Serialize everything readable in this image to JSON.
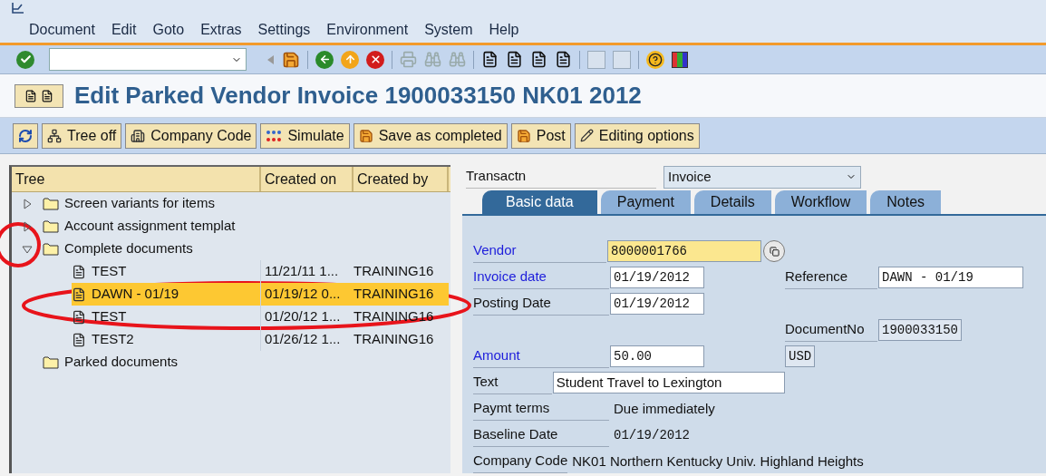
{
  "menu": [
    {
      "label": "Document"
    },
    {
      "label": "Edit"
    },
    {
      "label": "Goto"
    },
    {
      "label": "Extras"
    },
    {
      "label": "Settings"
    },
    {
      "label": "Environment"
    },
    {
      "label": "System"
    },
    {
      "label": "Help"
    }
  ],
  "title": "Edit Parked Vendor Invoice 1900033150 NK01 2012",
  "app_toolbar": [
    {
      "label": "Tree off"
    },
    {
      "label": "Company Code"
    },
    {
      "label": "Simulate"
    },
    {
      "label": "Save as completed"
    },
    {
      "label": "Post"
    },
    {
      "label": "Editing options"
    }
  ],
  "tree": {
    "columns": [
      "Tree",
      "Created on",
      "Created by"
    ],
    "items": [
      {
        "kind": "folder",
        "label": "Screen variants for items",
        "expanded": false,
        "selected": false
      },
      {
        "kind": "folder",
        "label": "Account assignment templat",
        "expanded": false,
        "selected": false
      },
      {
        "kind": "folder",
        "label": "Complete documents",
        "expanded": true,
        "selected": false,
        "children": [
          {
            "kind": "document",
            "label": "TEST",
            "created_on": "11/21/11  1...",
            "created_by": "TRAINING16",
            "selected": false
          },
          {
            "kind": "document",
            "label": "DAWN - 01/19",
            "created_on": "01/19/12  0...",
            "created_by": "TRAINING16",
            "selected": true
          },
          {
            "kind": "document",
            "label": "TEST",
            "created_on": "01/20/12  1...",
            "created_by": "TRAINING16",
            "selected": false
          },
          {
            "kind": "document",
            "label": "TEST2",
            "created_on": "01/26/12  1...",
            "created_by": "TRAINING16",
            "selected": false
          }
        ]
      },
      {
        "kind": "folder",
        "label": "Parked documents",
        "selected": false
      }
    ]
  },
  "transaction": {
    "label": "Transactn",
    "value": "Invoice"
  },
  "tabs": [
    {
      "label": "Basic data",
      "selected": true
    },
    {
      "label": "Payment",
      "selected": false
    },
    {
      "label": "Details",
      "selected": false
    },
    {
      "label": "Workflow",
      "selected": false
    },
    {
      "label": "Notes",
      "selected": false
    }
  ],
  "form_rows": [
    {
      "left": {
        "label": "Vendor",
        "required": true,
        "kind": "input",
        "value": "8000001766",
        "focused": true
      }
    },
    {
      "left": {
        "label": "Invoice date",
        "required": true,
        "kind": "input",
        "value": "01/19/2012",
        "focused": false
      },
      "right": {
        "label": "Reference",
        "kind": "input",
        "value": "DAWN - 01/19",
        "focused": false
      }
    },
    {
      "left": {
        "label": "Posting Date",
        "required": false,
        "kind": "input",
        "value": "01/19/2012",
        "focused": false
      }
    },
    {
      "right": {
        "label": "DocumentNo",
        "kind": "readonly",
        "value": "1900033150"
      }
    },
    {
      "left": {
        "label": "Amount",
        "required": true,
        "kind": "input",
        "value": "50.00",
        "focused": false
      },
      "right": {
        "kind": "readonly",
        "value": "USD"
      }
    },
    {
      "left": {
        "label": "Text",
        "required": false,
        "kind": "wide_input",
        "value": "Student Travel to Lexington"
      }
    },
    {
      "left": {
        "label": "Paymt terms",
        "required": false,
        "kind": "display",
        "value": "Due immediately"
      }
    },
    {
      "left": {
        "label": "Baseline Date",
        "required": false,
        "kind": "date_display",
        "value": "01/19/2012"
      }
    },
    {
      "left": {
        "label": "Company Code",
        "required": false,
        "kind": "display",
        "value": "NK01 Northern Kentucky Univ. Highland Heights"
      }
    }
  ]
}
